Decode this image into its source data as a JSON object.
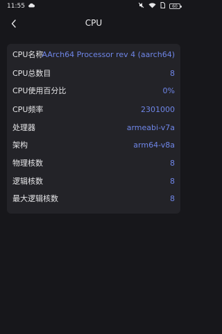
{
  "status_bar": {
    "time": "11:55",
    "battery": "60"
  },
  "header": {
    "title": "CPU"
  },
  "rows": [
    {
      "label": "CPU名称",
      "value": "AArch64 Processor rev 4 (aarch64)"
    },
    {
      "label": "CPU总数目",
      "value": "8"
    },
    {
      "label": "CPU使用百分比",
      "value": "0%"
    },
    {
      "label": "CPU频率",
      "value": "2301000"
    },
    {
      "label": "处理器",
      "value": "armeabi-v7a"
    },
    {
      "label": "架构",
      "value": "arm64-v8a"
    },
    {
      "label": "物理核数",
      "value": "8"
    },
    {
      "label": "逻辑核数",
      "value": "8"
    },
    {
      "label": "最大逻辑核数",
      "value": "8"
    }
  ]
}
